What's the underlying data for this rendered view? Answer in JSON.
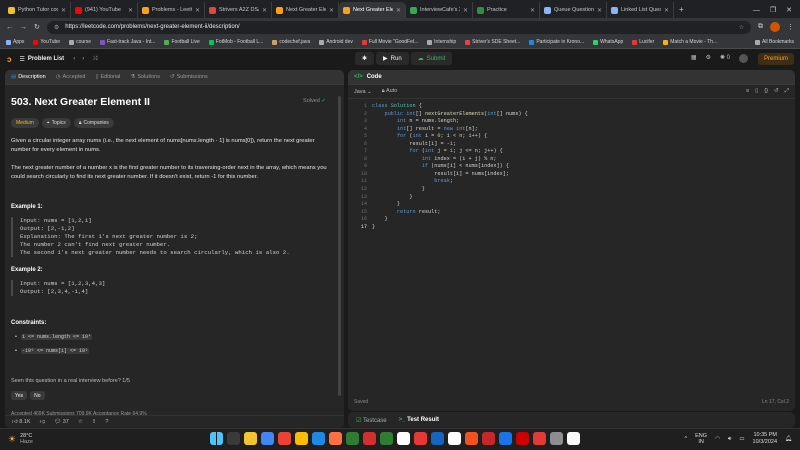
{
  "browser": {
    "tabs": [
      {
        "title": "Python Tutor code",
        "color": "#f2c12e",
        "active": false
      },
      {
        "title": "(941) YouTube",
        "color": "#ff0000",
        "active": false
      },
      {
        "title": "Problems - LeetCo",
        "color": "#ffa116",
        "active": false
      },
      {
        "title": "Strivers A2Z DSA",
        "color": "#e5463b",
        "active": false
      },
      {
        "title": "Next Greater Elem",
        "color": "#ffa116",
        "active": false
      },
      {
        "title": "Next Greater Elem",
        "color": "#ffa116",
        "active": true
      },
      {
        "title": "InterviewCafe's 25",
        "color": "#34a853",
        "active": false
      },
      {
        "title": "Practice",
        "color": "#2f8d46",
        "active": false
      },
      {
        "title": "Queue Questions",
        "color": "#8ab4f8",
        "active": false
      },
      {
        "title": "Linked List Questi",
        "color": "#8ab4f8",
        "active": false
      }
    ],
    "url": "https://leetcode.com/problems/next-greater-element-ii/description/",
    "bookmarks": [
      {
        "label": "Apps",
        "color": "#8ab4f8"
      },
      {
        "label": "YouTube",
        "color": "#ff0000"
      },
      {
        "label": "course",
        "color": "#aaaaaa"
      },
      {
        "label": "Fast-track Java - Int...",
        "color": "#7e57c2"
      },
      {
        "label": "Football Live",
        "color": "#4caf50"
      },
      {
        "label": "FotMob - Football L...",
        "color": "#00c853"
      },
      {
        "label": "codechef.java",
        "color": "#c8a165"
      },
      {
        "label": "Android dev",
        "color": "#aaaaaa"
      },
      {
        "label": "Full Movie \"GoodFel...",
        "color": "#e53935"
      },
      {
        "label": "Internship",
        "color": "#aaaaaa"
      },
      {
        "label": "Striver's SDE Sheet...",
        "color": "#e5463b"
      },
      {
        "label": "Participate in Krono...",
        "color": "#1e88e5"
      },
      {
        "label": "WhatsApp",
        "color": "#25d366"
      },
      {
        "label": "Lucifer",
        "color": "#e53935"
      },
      {
        "label": "Match a Movie - Th...",
        "color": "#ffb300"
      }
    ],
    "all_bookmarks": "All Bookmarks"
  },
  "nav": {
    "problem_list": "Problem List",
    "run": "Run",
    "submit": "Submit",
    "premium": "Premium",
    "streak": "0"
  },
  "left_tabs": [
    "Description",
    "Accepted",
    "Editorial",
    "Solutions",
    "Submissions"
  ],
  "problem": {
    "title": "503. Next Greater Element II",
    "status": "Solved",
    "difficulty": "Medium",
    "topics": "Topics",
    "companies": "Companies",
    "desc1": "Given a circular integer array nums (i.e., the next element of nums[nums.length - 1] is nums[0]), return the next greater number for every element in nums.",
    "desc2": "The next greater number of a number x is the first greater number to its traversing-order next in the array, which means you could search circularly to find its next greater number. If it doesn't exist, return -1 for this number.",
    "ex1_title": "Example 1:",
    "ex1": "Input: nums = [1,2,1]\nOutput: [2,-1,2]\nExplanation: The first 1's next greater number is 2;\nThe number 2 can't find next greater number.\nThe second 1's next greater number needs to search circularly, which is also 2.",
    "ex2_title": "Example 2:",
    "ex2": "Input: nums = [1,2,3,4,3]\nOutput: [2,3,4,-1,4]",
    "constraints_title": "Constraints:",
    "constraints": [
      "1 <= nums.length <= 10⁴",
      "-10⁹ <= nums[i] <= 10⁹"
    ],
    "seen": "Seen this question in a real interview before?   1/5",
    "yes": "Yes",
    "no": "No",
    "stats": "Accepted 469K    Submissions 709.9K    Acceptance Rate 64.9%",
    "likes": "8.1K",
    "comments": "37"
  },
  "code": {
    "title": "Code",
    "language": "Java",
    "mode": "Auto",
    "saved": "Saved",
    "cursor": "Ln 17, Col 2",
    "lines": [
      "class Solution {",
      "    public int[] nextGreaterElements(int[] nums) {",
      "        int n = nums.length;",
      "        int[] result = new int[n];",
      "        for (int i = 0; i < n; i++) {",
      "            result[i] = -1;",
      "            for (int j = 1; j <= n; j++) {",
      "                int index = (i + j) % n;",
      "                if (nums[i] < nums[index]) {",
      "                    result[i] = nums[index];",
      "                    break;",
      "                }",
      "            }",
      "        }",
      "        return result;",
      "    }",
      "}"
    ]
  },
  "test": {
    "testcase": "Testcase",
    "result": "Test Result"
  },
  "taskbar": {
    "temp": "28°C",
    "weather": "Haze",
    "lang1": "ENG",
    "lang2": "IN",
    "time": "10:35 PM",
    "date": "10/3/2024",
    "apps": [
      "#ffffff",
      "#3a3a3a",
      "#f4c430",
      "#4285f4",
      "#ea4335",
      "#fbbc05",
      "#1e88e5",
      "#ff7043",
      "#2e7d32",
      "#d32f2f",
      "#2e7d32",
      "#ffffff",
      "#e53935",
      "#1565c0",
      "#ffffff",
      "#f4511e",
      "#c62828",
      "#1a73e8",
      "#cc0000",
      "#e53935",
      "#8e8e8e",
      "#fafafa"
    ]
  }
}
